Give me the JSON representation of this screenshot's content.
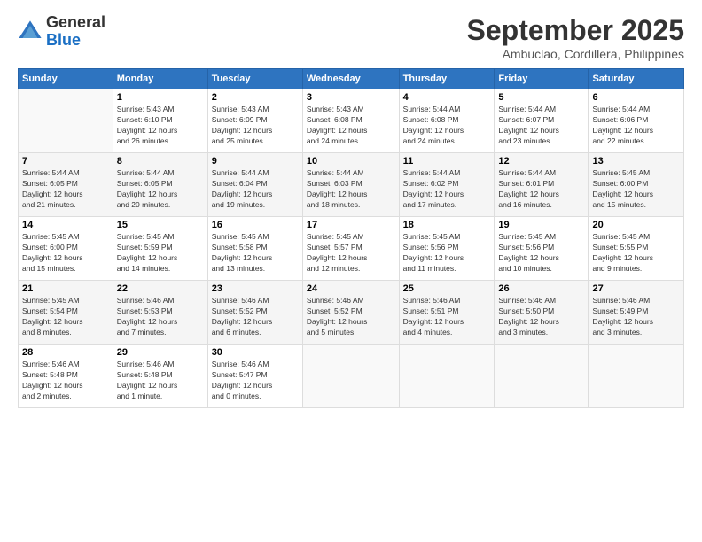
{
  "logo": {
    "general": "General",
    "blue": "Blue"
  },
  "header": {
    "month": "September 2025",
    "location": "Ambuclao, Cordillera, Philippines"
  },
  "weekdays": [
    "Sunday",
    "Monday",
    "Tuesday",
    "Wednesday",
    "Thursday",
    "Friday",
    "Saturday"
  ],
  "weeks": [
    [
      {
        "day": "",
        "info": ""
      },
      {
        "day": "1",
        "info": "Sunrise: 5:43 AM\nSunset: 6:10 PM\nDaylight: 12 hours\nand 26 minutes."
      },
      {
        "day": "2",
        "info": "Sunrise: 5:43 AM\nSunset: 6:09 PM\nDaylight: 12 hours\nand 25 minutes."
      },
      {
        "day": "3",
        "info": "Sunrise: 5:43 AM\nSunset: 6:08 PM\nDaylight: 12 hours\nand 24 minutes."
      },
      {
        "day": "4",
        "info": "Sunrise: 5:44 AM\nSunset: 6:08 PM\nDaylight: 12 hours\nand 24 minutes."
      },
      {
        "day": "5",
        "info": "Sunrise: 5:44 AM\nSunset: 6:07 PM\nDaylight: 12 hours\nand 23 minutes."
      },
      {
        "day": "6",
        "info": "Sunrise: 5:44 AM\nSunset: 6:06 PM\nDaylight: 12 hours\nand 22 minutes."
      }
    ],
    [
      {
        "day": "7",
        "info": "Sunrise: 5:44 AM\nSunset: 6:05 PM\nDaylight: 12 hours\nand 21 minutes."
      },
      {
        "day": "8",
        "info": "Sunrise: 5:44 AM\nSunset: 6:05 PM\nDaylight: 12 hours\nand 20 minutes."
      },
      {
        "day": "9",
        "info": "Sunrise: 5:44 AM\nSunset: 6:04 PM\nDaylight: 12 hours\nand 19 minutes."
      },
      {
        "day": "10",
        "info": "Sunrise: 5:44 AM\nSunset: 6:03 PM\nDaylight: 12 hours\nand 18 minutes."
      },
      {
        "day": "11",
        "info": "Sunrise: 5:44 AM\nSunset: 6:02 PM\nDaylight: 12 hours\nand 17 minutes."
      },
      {
        "day": "12",
        "info": "Sunrise: 5:44 AM\nSunset: 6:01 PM\nDaylight: 12 hours\nand 16 minutes."
      },
      {
        "day": "13",
        "info": "Sunrise: 5:45 AM\nSunset: 6:00 PM\nDaylight: 12 hours\nand 15 minutes."
      }
    ],
    [
      {
        "day": "14",
        "info": "Sunrise: 5:45 AM\nSunset: 6:00 PM\nDaylight: 12 hours\nand 15 minutes."
      },
      {
        "day": "15",
        "info": "Sunrise: 5:45 AM\nSunset: 5:59 PM\nDaylight: 12 hours\nand 14 minutes."
      },
      {
        "day": "16",
        "info": "Sunrise: 5:45 AM\nSunset: 5:58 PM\nDaylight: 12 hours\nand 13 minutes."
      },
      {
        "day": "17",
        "info": "Sunrise: 5:45 AM\nSunset: 5:57 PM\nDaylight: 12 hours\nand 12 minutes."
      },
      {
        "day": "18",
        "info": "Sunrise: 5:45 AM\nSunset: 5:56 PM\nDaylight: 12 hours\nand 11 minutes."
      },
      {
        "day": "19",
        "info": "Sunrise: 5:45 AM\nSunset: 5:56 PM\nDaylight: 12 hours\nand 10 minutes."
      },
      {
        "day": "20",
        "info": "Sunrise: 5:45 AM\nSunset: 5:55 PM\nDaylight: 12 hours\nand 9 minutes."
      }
    ],
    [
      {
        "day": "21",
        "info": "Sunrise: 5:45 AM\nSunset: 5:54 PM\nDaylight: 12 hours\nand 8 minutes."
      },
      {
        "day": "22",
        "info": "Sunrise: 5:46 AM\nSunset: 5:53 PM\nDaylight: 12 hours\nand 7 minutes."
      },
      {
        "day": "23",
        "info": "Sunrise: 5:46 AM\nSunset: 5:52 PM\nDaylight: 12 hours\nand 6 minutes."
      },
      {
        "day": "24",
        "info": "Sunrise: 5:46 AM\nSunset: 5:52 PM\nDaylight: 12 hours\nand 5 minutes."
      },
      {
        "day": "25",
        "info": "Sunrise: 5:46 AM\nSunset: 5:51 PM\nDaylight: 12 hours\nand 4 minutes."
      },
      {
        "day": "26",
        "info": "Sunrise: 5:46 AM\nSunset: 5:50 PM\nDaylight: 12 hours\nand 3 minutes."
      },
      {
        "day": "27",
        "info": "Sunrise: 5:46 AM\nSunset: 5:49 PM\nDaylight: 12 hours\nand 3 minutes."
      }
    ],
    [
      {
        "day": "28",
        "info": "Sunrise: 5:46 AM\nSunset: 5:48 PM\nDaylight: 12 hours\nand 2 minutes."
      },
      {
        "day": "29",
        "info": "Sunrise: 5:46 AM\nSunset: 5:48 PM\nDaylight: 12 hours\nand 1 minute."
      },
      {
        "day": "30",
        "info": "Sunrise: 5:46 AM\nSunset: 5:47 PM\nDaylight: 12 hours\nand 0 minutes."
      },
      {
        "day": "",
        "info": ""
      },
      {
        "day": "",
        "info": ""
      },
      {
        "day": "",
        "info": ""
      },
      {
        "day": "",
        "info": ""
      }
    ]
  ]
}
